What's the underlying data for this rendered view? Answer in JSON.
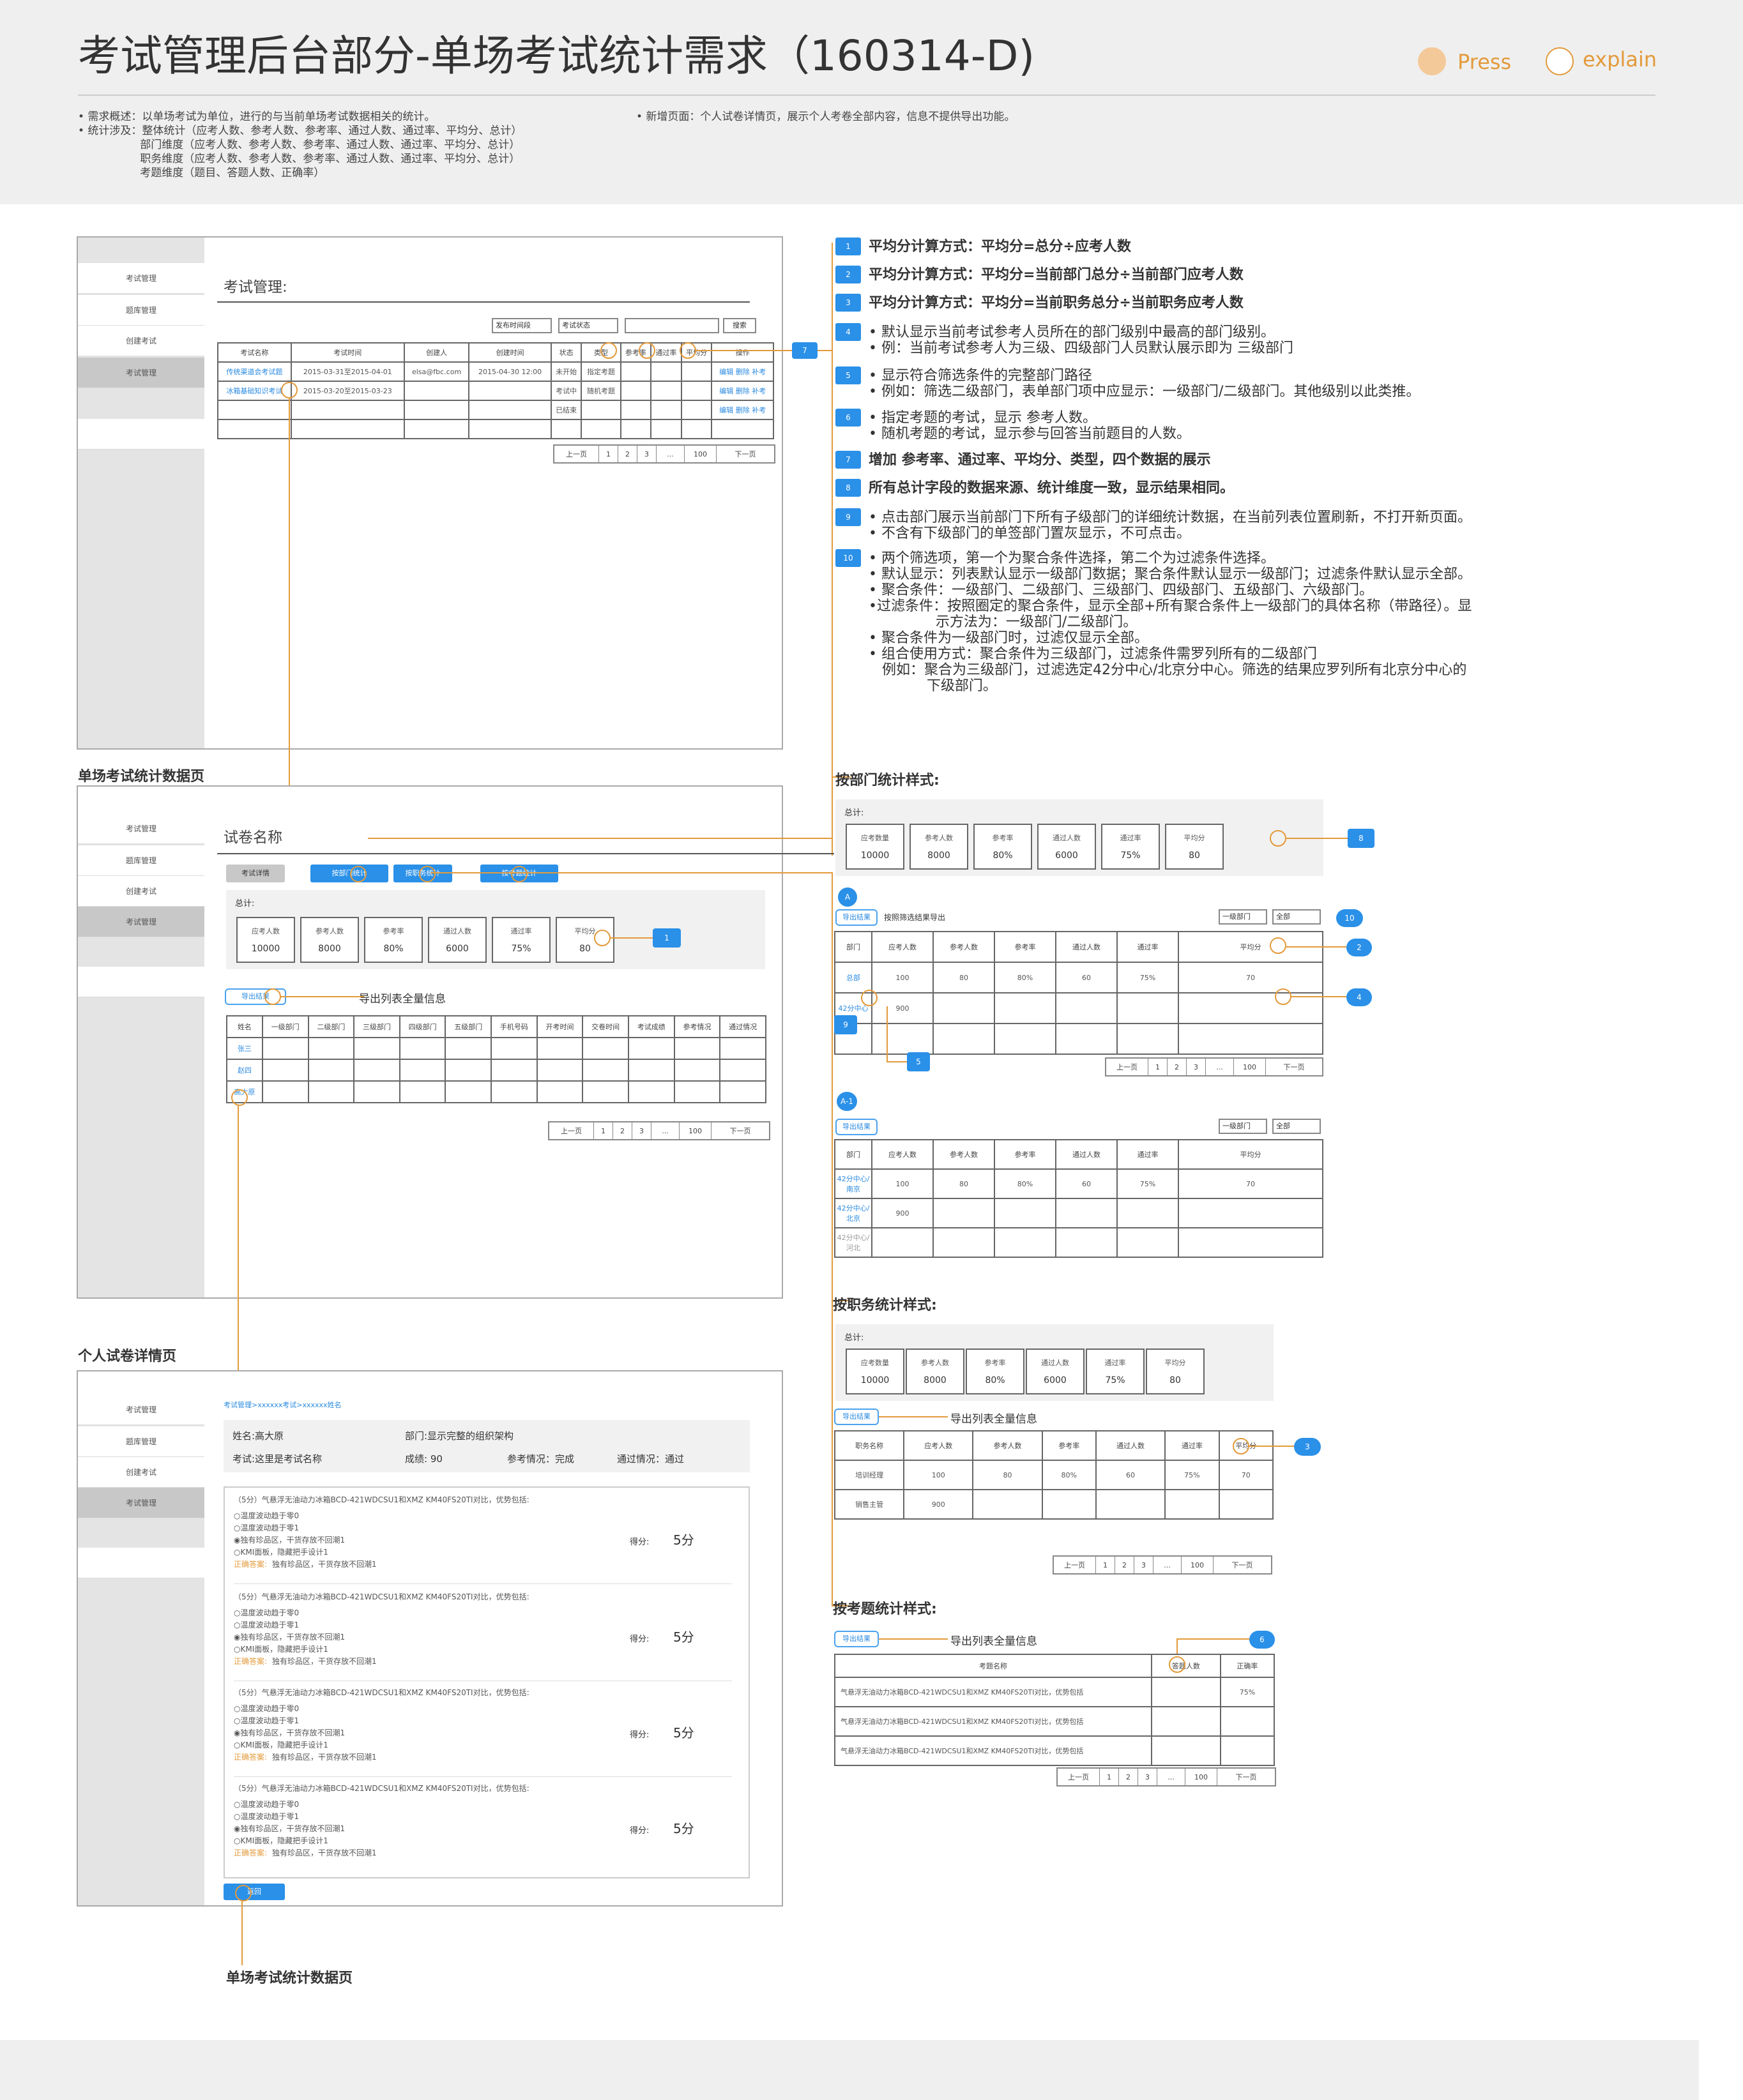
{
  "header": {
    "title": "考试管理后台部分-单场考试统计需求（160314-D)",
    "legend_press": "Press",
    "legend_explain": "explain",
    "summary_left": "• 需求概述：以单场考试为单位，进行的与当前单场考试数据相关的统计。\n• 统计涉及：整体统计（应考人数、参考人数、参考率、通过人数、通过率、平均分、总计）\n                  部门维度（应考人数、参考人数、参考率、通过人数、通过率、平均分、总计）\n                  职务维度（应考人数、参考人数、参考率、通过人数、通过率、平均分、总计）\n                  考题维度（题目、答题人数、正确率）",
    "summary_right": "• 新增页面：个人试卷详情页，展示个人考卷全部内容，信息不提供导出功能。"
  },
  "sidebar": [
    "考试管理",
    "题库管理",
    "创建考试",
    "考试管理"
  ],
  "screen1": {
    "title": "考试管理:",
    "filter1": "发布时间段",
    "filter2": "考试状态",
    "search": "搜索",
    "cols": [
      "考试名称",
      "考试时间",
      "创建人",
      "创建时间",
      "状态",
      "类型",
      "参考率",
      "通过率",
      "平均分",
      "操作"
    ],
    "rows": [
      [
        "传统渠道会考试题",
        "2015-03-31至2015-04-01",
        "elsa@fbc.com",
        "2015-04-30 12:00",
        "未开始",
        "指定考题",
        "",
        "",
        "",
        "编辑 删除 补考"
      ],
      [
        "冰箱基础知识考试",
        "2015-03-20至2015-03-23",
        "",
        "",
        "考试中",
        "随机考题",
        "",
        "",
        "",
        "编辑 删除 补考"
      ],
      [
        "",
        "",
        "",
        "",
        "已结束",
        "",
        "",
        "",
        "",
        "编辑 删除 补考"
      ]
    ],
    "pager": [
      "上一页",
      "1",
      "2",
      "3",
      "...",
      "100",
      "下一页"
    ]
  },
  "notes": [
    {
      "n": "1",
      "t": "平均分计算方式：平均分=总分÷应考人数"
    },
    {
      "n": "2",
      "t": "平均分计算方式：平均分=当前部门总分÷当前部门应考人数"
    },
    {
      "n": "3",
      "t": "平均分计算方式：平均分=当前职务总分÷当前职务应考人数"
    },
    {
      "n": "4",
      "t": "• 默认显示当前考试参考人员所在的部门级别中最高的部门级别。\n• 例：当前考试参考人为三级、四级部门人员默认展示即为 三级部门"
    },
    {
      "n": "5",
      "t": "• 显示符合筛选条件的完整部门路径\n• 例如：筛选二级部门，表单部门项中应显示：一级部门/二级部门。其他级别以此类推。"
    },
    {
      "n": "6",
      "t": "• 指定考题的考试，显示 参考人数。\n• 随机考题的考试，显示参与回答当前题目的人数。"
    },
    {
      "n": "7",
      "t": "增加 参考率、通过率、平均分、类型，四个数据的展示"
    },
    {
      "n": "8",
      "t": "所有总计字段的数据来源、统计维度一致，显示结果相同。"
    },
    {
      "n": "9",
      "t": "• 点击部门展示当前部门下所有子级部门的详细统计数据，在当前列表位置刷新，不打开新页面。\n• 不含有下级部门的单签部门置灰显示，不可点击。"
    },
    {
      "n": "10",
      "t": "• 两个筛选项，第一个为聚合条件选择，第二个为过滤条件选择。\n• 默认显示：列表默认显示一级部门数据；聚合条件默认显示一级部门；过滤条件默认显示全部。\n• 聚合条件：一级部门、二级部门、三级部门、四级部门、五级部门、六级部门。\n•过滤条件：按照圈定的聚合条件，显示全部+所有聚合条件上一级部门的具体名称（带路径）。显\n               示方法为：一级部门/二级部门。\n• 聚合条件为一级部门时，过滤仅显示全部。\n• 组合使用方式：聚合条件为三级部门，过滤条件需罗列所有的二级部门\n   例如：聚合为三级部门，过滤选定42分中心/北京分中心。筛选的结果应罗列所有北京分中心的\n             下级部门。"
    }
  ],
  "labels": {
    "s2": "单场考试统计数据页",
    "s3": "个人试卷详情页",
    "s4": "单场考试统计数据页",
    "dept": "按部门统计样式:",
    "pos": "按职务统计样式:",
    "q": "按考题统计样式:",
    "export_all": "导出列表全量信息",
    "export_filter": "按照筛选结果导出"
  },
  "screen2": {
    "title": "试卷名称",
    "tabs": [
      "考试详情",
      "按部门统计",
      "按职务统计",
      "按考题统计"
    ],
    "total": "总计:",
    "stats": [
      [
        "应考人数",
        "10000"
      ],
      [
        "参考人数",
        "8000"
      ],
      [
        "参考率",
        "80%"
      ],
      [
        "通过人数",
        "6000"
      ],
      [
        "通过率",
        "75%"
      ],
      [
        "平均分",
        "80"
      ]
    ],
    "export": "导出结果",
    "cols": [
      "姓名",
      "一级部门",
      "二级部门",
      "三级部门",
      "四级部门",
      "五级部门",
      "手机号码",
      "开考时间",
      "交卷时间",
      "考试成绩",
      "参考情况",
      "通过情况"
    ],
    "names": [
      "张三",
      "赵四",
      "高大原"
    ]
  },
  "dept": {
    "total": "总计:",
    "stats": [
      [
        "应考数量",
        "10000"
      ],
      [
        "参考人数",
        "8000"
      ],
      [
        "参考率",
        "80%"
      ],
      [
        "通过人数",
        "6000"
      ],
      [
        "通过率",
        "75%"
      ],
      [
        "平均分",
        "80"
      ]
    ],
    "A": "A",
    "A1": "A-1",
    "export": "导出结果",
    "sel1": "一级部门",
    "sel2": "全部",
    "cols": [
      "部门",
      "应考人数",
      "参考人数",
      "参考率",
      "通过人数",
      "通过率",
      "平均分"
    ],
    "rowsA": [
      [
        "总部",
        "100",
        "80",
        "80%",
        "60",
        "75%",
        "70"
      ],
      [
        "42分中心",
        "900",
        "",
        "",
        "",
        "",
        ""
      ]
    ],
    "rowsA1": [
      [
        "42分中心/南京",
        "100",
        "80",
        "80%",
        "60",
        "75%",
        "70"
      ],
      [
        "42分中心/北京",
        "900",
        "",
        "",
        "",
        "",
        ""
      ],
      [
        "42分中心/河北",
        "",
        "",
        "",
        "",
        "",
        ""
      ]
    ]
  },
  "pos": {
    "cols": [
      "职务名称",
      "应考人数",
      "参考人数",
      "参考率",
      "通过人数",
      "通过率",
      "平均分"
    ],
    "rows": [
      [
        "培训经理",
        "100",
        "80",
        "80%",
        "60",
        "75%",
        "70"
      ],
      [
        "销售主管",
        "900",
        "",
        "",
        "",
        "",
        ""
      ]
    ]
  },
  "q": {
    "cols": [
      "考题名称",
      "答题人数",
      "正确率"
    ],
    "rowtext": "气悬浮无油动力冰箱BCD-421WDCSU1和XMZ KM40FS20TI对比，优势包括",
    "rate": "75%"
  },
  "screen3": {
    "crumb": "考试管理>xxxxxx考试>xxxxxx姓名",
    "name": "姓名:高大原",
    "dept": "部门:显示完整的组织架构",
    "exam": "考试:这里是考试名称",
    "score": "成绩: 90",
    "join": "参考情况：完成",
    "pass": "通过情况：通过",
    "qtitle": "（5分）气悬浮无油动力冰箱BCD-421WDCSU1和XMZ KM40FS20TI对比，优势包括:",
    "opts": "○温度波动趋于零0\n○温度波动趋于零1\n◉独有珍品区，干货存放不回潮1\n○KMI面板，隐藏把手设计1",
    "ansL": "正确答案:",
    "ans": "独有珍品区，干货存放不回潮1",
    "gotL": "得分:",
    "got": "5分",
    "back": "返回"
  },
  "colors": {
    "accent": "#e39a3b",
    "blue": "#2a90e8"
  }
}
